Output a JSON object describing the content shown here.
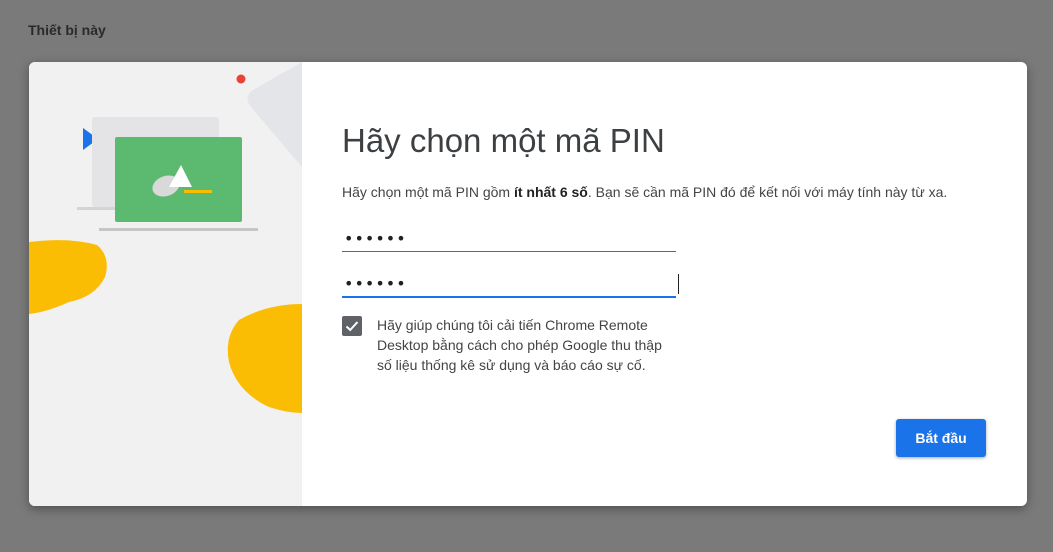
{
  "section": {
    "title": "Thiết bị này"
  },
  "dialog": {
    "heading": "Hãy chọn một mã PIN",
    "description": {
      "before": "Hãy chọn một mã PIN gồm ",
      "bold": "ít nhất 6 số",
      "after": ". Bạn sẽ cần mã PIN đó để kết nối với máy tính này từ xa."
    },
    "pin_field": {
      "value": "••••••"
    },
    "pin_confirm_field": {
      "value": "••••••"
    },
    "improve_checkbox": {
      "checked": true,
      "label": "Hãy giúp chúng tôi cải tiến Chrome Remote Desktop bằng cách cho phép Google thu thập số liệu thống kê sử dụng và báo cáo sự cố."
    },
    "start_button": {
      "label": "Bắt đầu"
    }
  },
  "colors": {
    "accent": "#1a73e8",
    "laptop_screen": "#5bba6f",
    "blob": "#fbbc04",
    "dot": "#ea4335"
  }
}
